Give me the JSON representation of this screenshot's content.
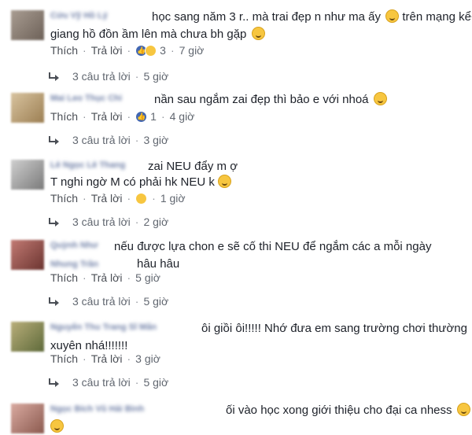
{
  "comments": [
    {
      "author": "Cứu Vỹ Hồ Lý",
      "line1": "học sang năm 3 r.. mà trai đẹp n như ma ấy",
      "line1_tail": "trên mạng kể+",
      "line2": "giang hồ đồn ầm lên mà chưa bh gặp",
      "like": "Thích",
      "reply": "Trả lời",
      "reactions": "3",
      "time": "7 giờ",
      "replies_count": "3 câu trả lời",
      "replies_time": "5 giờ"
    },
    {
      "author": "Mai Leo Thục Chi",
      "line1": "nần sau ngắm zai đẹp thì bảo e với nhoá",
      "line2": "",
      "like": "Thích",
      "reply": "Trả lời",
      "reactions": "1",
      "time": "4 giờ",
      "replies_count": "3 câu trả lời",
      "replies_time": "3 giờ"
    },
    {
      "author": "Lê Ngọc Lê Thang",
      "line1": "zai NEU đẩy m ợ",
      "line2": "T nghi ngờ M có phải hk NEU k",
      "like": "Thích",
      "reply": "Trả lời",
      "reactions": "",
      "time": "1 giờ",
      "replies_count": "3 câu trả lời",
      "replies_time": "2 giờ"
    },
    {
      "author": "Quỳnh Như",
      "line1": "nếu được lựa chon e sẽ cố thi NEU để ngắm các a mỗi ngày",
      "line2_name": "Nhung Trần",
      "line2": "hâu hâu",
      "like": "Thích",
      "reply": "Trả lời",
      "reactions": "",
      "time": "5 giờ",
      "replies_count": "3 câu trả lời",
      "replies_time": "5 giờ"
    },
    {
      "author": "Nguyễn Thu Trang Sĩ Mẫn",
      "line1": "ôi giồi ôi!!!!! Nhớ đưa em sang trường chơi thường",
      "line2": "xuyên nhá!!!!!!!",
      "like": "Thích",
      "reply": "Trả lời",
      "reactions": "",
      "time": "3 giờ",
      "replies_count": "3 câu trả lời",
      "replies_time": "5 giờ"
    },
    {
      "author": "Ngọc Bích Vũ Hải Bình",
      "line1": "ối vào học xong giới thiệu cho đại ca nhess",
      "line2": ""
    }
  ]
}
